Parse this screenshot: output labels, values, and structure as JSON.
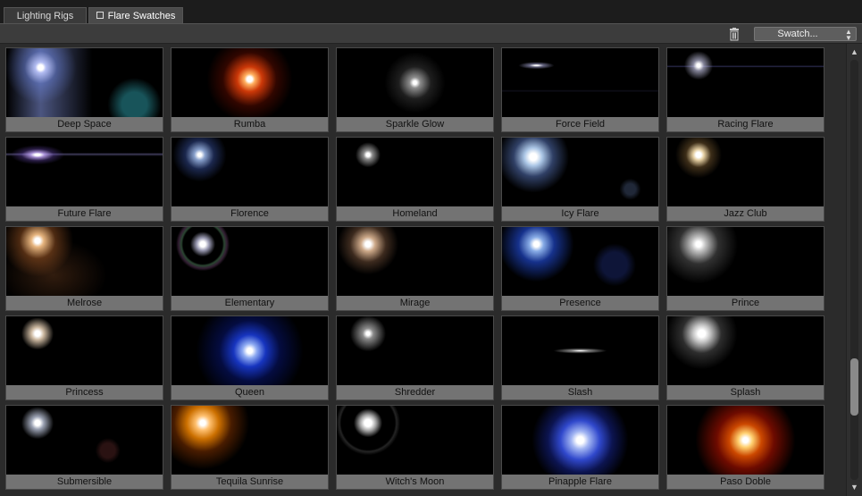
{
  "tabs": [
    {
      "label": "Lighting Rigs"
    },
    {
      "label": "Flare Swatches"
    }
  ],
  "toolbar": {
    "select_value": "Swatch...",
    "trash_icon": "trash-icon"
  },
  "swatches": [
    {
      "label": "Deep Space"
    },
    {
      "label": "Rumba"
    },
    {
      "label": "Sparkle Glow"
    },
    {
      "label": "Force Field"
    },
    {
      "label": "Racing Flare"
    },
    {
      "label": "Future Flare"
    },
    {
      "label": "Florence"
    },
    {
      "label": "Homeland"
    },
    {
      "label": "Icy Flare"
    },
    {
      "label": "Jazz Club"
    },
    {
      "label": "Melrose"
    },
    {
      "label": "Elementary"
    },
    {
      "label": "Mirage"
    },
    {
      "label": "Presence"
    },
    {
      "label": "Prince"
    },
    {
      "label": "Princess"
    },
    {
      "label": "Queen"
    },
    {
      "label": "Shredder"
    },
    {
      "label": "Slash"
    },
    {
      "label": "Splash"
    },
    {
      "label": "Submersible"
    },
    {
      "label": "Tequila Sunrise"
    },
    {
      "label": "Witch's Moon"
    },
    {
      "label": "Pinapple Flare"
    },
    {
      "label": "Paso Doble"
    }
  ],
  "colors": {
    "background": "#2b2b2b",
    "label_bar": "#737373",
    "thumb_bg": "#000000"
  }
}
